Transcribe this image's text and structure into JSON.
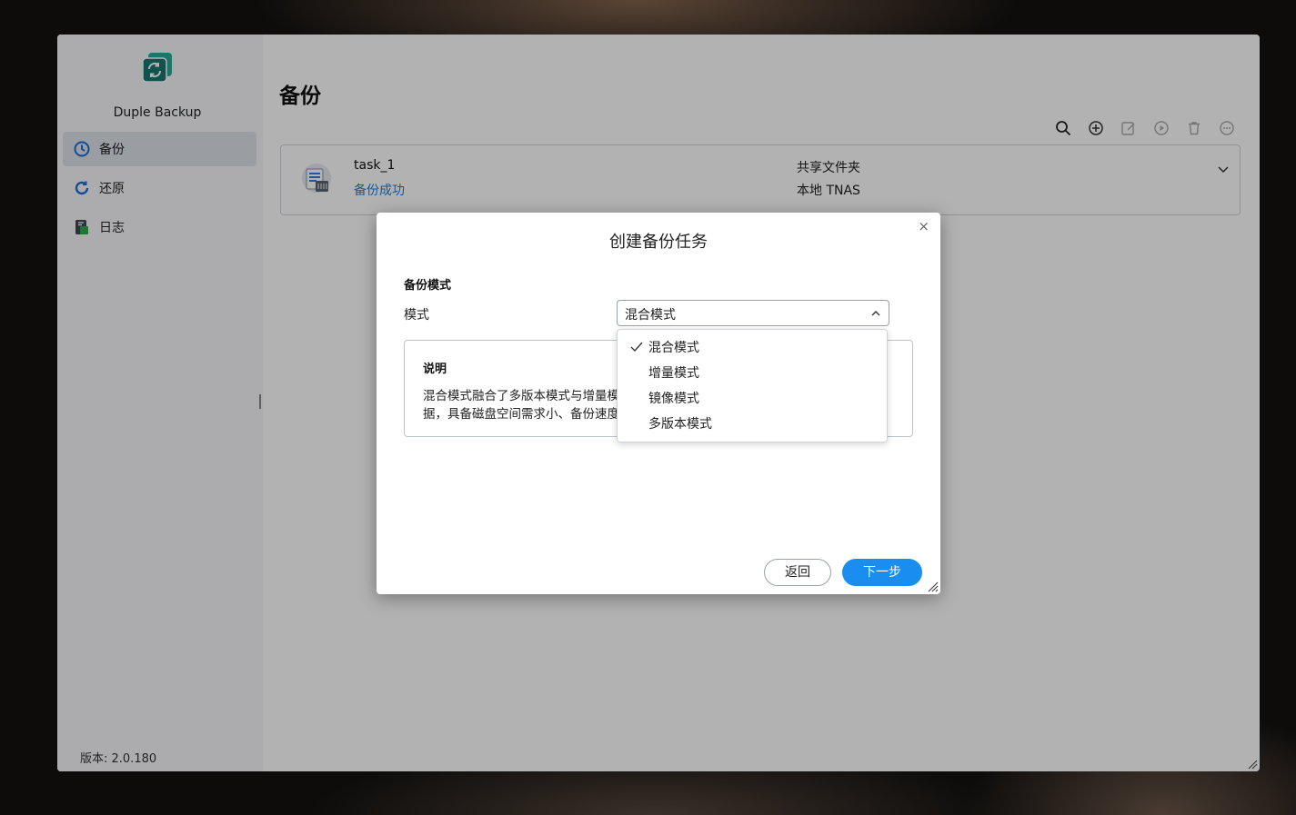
{
  "app": {
    "name": "Duple Backup",
    "version_label": "版本: 2.0.180"
  },
  "sidebar": {
    "items": [
      {
        "label": "备份",
        "icon": "clock-icon",
        "active": true
      },
      {
        "label": "还原",
        "icon": "refresh-icon",
        "active": false
      },
      {
        "label": "日志",
        "icon": "log-icon",
        "active": false
      }
    ]
  },
  "main": {
    "title": "备份",
    "toolbar": [
      "search-icon",
      "add-icon",
      "edit-icon",
      "play-icon",
      "trash-icon",
      "more-icon"
    ]
  },
  "task": {
    "name": "task_1",
    "status": "备份成功",
    "dest_type": "共享文件夹",
    "dest": "本地 TNAS"
  },
  "dialog": {
    "title": "创建备份任务",
    "close_glyph": "×",
    "section_title": "备份模式",
    "mode_label": "模式",
    "selected_mode": "混合模式",
    "options": [
      "混合模式",
      "增量模式",
      "镜像模式",
      "多版本模式"
    ],
    "desc_title": "说明",
    "desc_text": "混合模式融合了多版本模式与增量模式\n据，具备磁盘空间需求小、备份速度",
    "back_label": "返回",
    "next_label": "下一步"
  },
  "colors": {
    "accent": "#1a8ef0",
    "status_success": "#1d7ee0",
    "logo_teal": "#1f8f86"
  }
}
